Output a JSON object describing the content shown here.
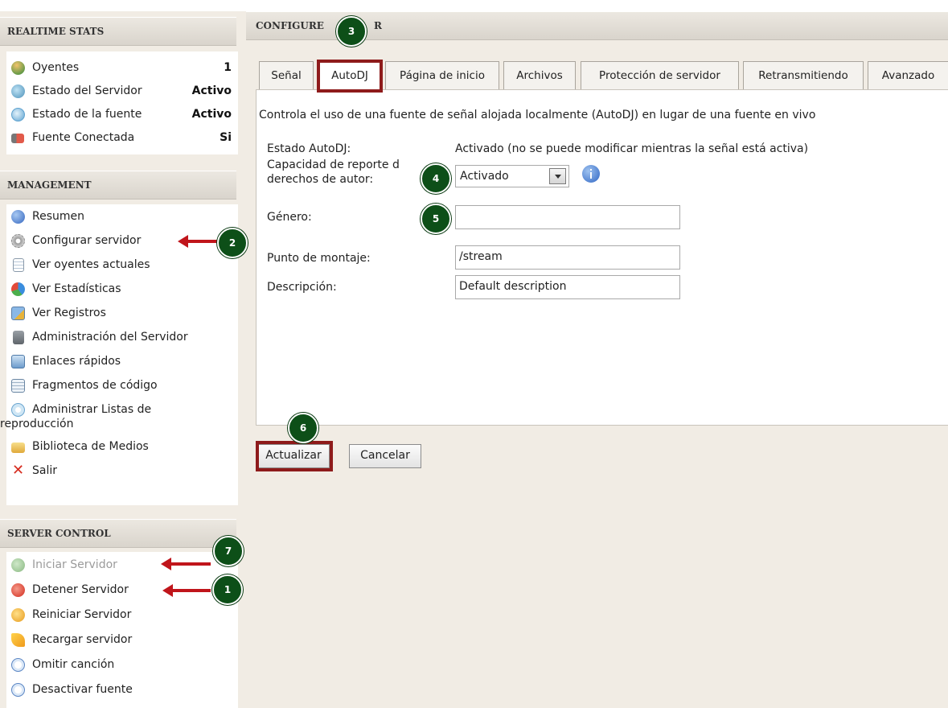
{
  "sidebar": {
    "realtime": {
      "title": "REALTIME STATS",
      "rows": [
        {
          "label": "Oyentes",
          "value": "1",
          "icon": "users-icon"
        },
        {
          "label": "Estado del Servidor",
          "value": "Activo",
          "icon": "server-status-icon"
        },
        {
          "label": "Estado de la fuente",
          "value": "Activo",
          "icon": "source-status-icon"
        },
        {
          "label": "Fuente Conectada",
          "value": "Si",
          "icon": "speaker-icon"
        }
      ]
    },
    "management": {
      "title": "MANAGEMENT",
      "items": [
        {
          "label": "Resumen",
          "icon": "info-icon"
        },
        {
          "label": "Configurar servidor",
          "icon": "gear-icon"
        },
        {
          "label": "Ver oyentes actuales",
          "icon": "document-icon"
        },
        {
          "label": "Ver Estadísticas",
          "icon": "pie-chart-icon"
        },
        {
          "label": "Ver Registros",
          "icon": "log-icon"
        },
        {
          "label": "Administración del Servidor",
          "icon": "server-admin-icon"
        },
        {
          "label": "Enlaces rápidos",
          "icon": "links-icon"
        },
        {
          "label": "Fragmentos de código",
          "icon": "code-snippet-icon"
        },
        {
          "label": "Administrar Listas de",
          "label2": "reproducción",
          "icon": "playlist-icon"
        },
        {
          "label": "Biblioteca de Medios",
          "icon": "folder-icon"
        },
        {
          "label": "Salir",
          "icon": "exit-x-icon"
        }
      ]
    },
    "server_control": {
      "title": "SERVER CONTROL",
      "items": [
        {
          "label": "Iniciar Servidor",
          "icon": "play-icon",
          "disabled": true
        },
        {
          "label": "Detener Servidor",
          "icon": "stop-icon"
        },
        {
          "label": "Reiniciar Servidor",
          "icon": "restart-icon"
        },
        {
          "label": "Recargar servidor",
          "icon": "reload-icon"
        },
        {
          "label": "Omitir canción",
          "icon": "skip-icon"
        },
        {
          "label": "Desactivar fuente",
          "icon": "pause-icon"
        }
      ]
    }
  },
  "main": {
    "title_left": "CONFIGURE",
    "title_right": "R",
    "tabs": [
      {
        "label": "Señal"
      },
      {
        "label": "AutoDJ",
        "active": true
      },
      {
        "label": "Página de inicio"
      },
      {
        "label": "Archivos"
      },
      {
        "label": "Protección de servidor"
      },
      {
        "label": "Retransmitiendo"
      },
      {
        "label": "Avanzado"
      }
    ],
    "description": "Controla el uso de una fuente de señal alojada localmente (AutoDJ) en lugar de una fuente en vivo",
    "autodj_status_label": "Estado AutoDJ:",
    "autodj_status_value": "Activado (no se puede modificar mientras la señal está activa)",
    "copyright_label_1": "Capacidad de reporte d",
    "copyright_label_2": "derechos de autor:",
    "copyright_value": "Activado",
    "genre_label": "Género:",
    "genre_value": "",
    "mount_label": "Punto de montaje:",
    "mount_value": "/stream",
    "desc_label": "Descripción:",
    "desc_value": "Default description",
    "update_button": "Actualizar",
    "cancel_button": "Cancelar"
  },
  "annotations": {
    "b1": "1",
    "b2": "2",
    "b3": "3",
    "b4": "4",
    "b5": "5",
    "b6": "6",
    "b7": "7",
    "highlight_color": "#8e1b1b",
    "arrow_color": "#c0151b",
    "badge_color": "#0d4f18"
  }
}
